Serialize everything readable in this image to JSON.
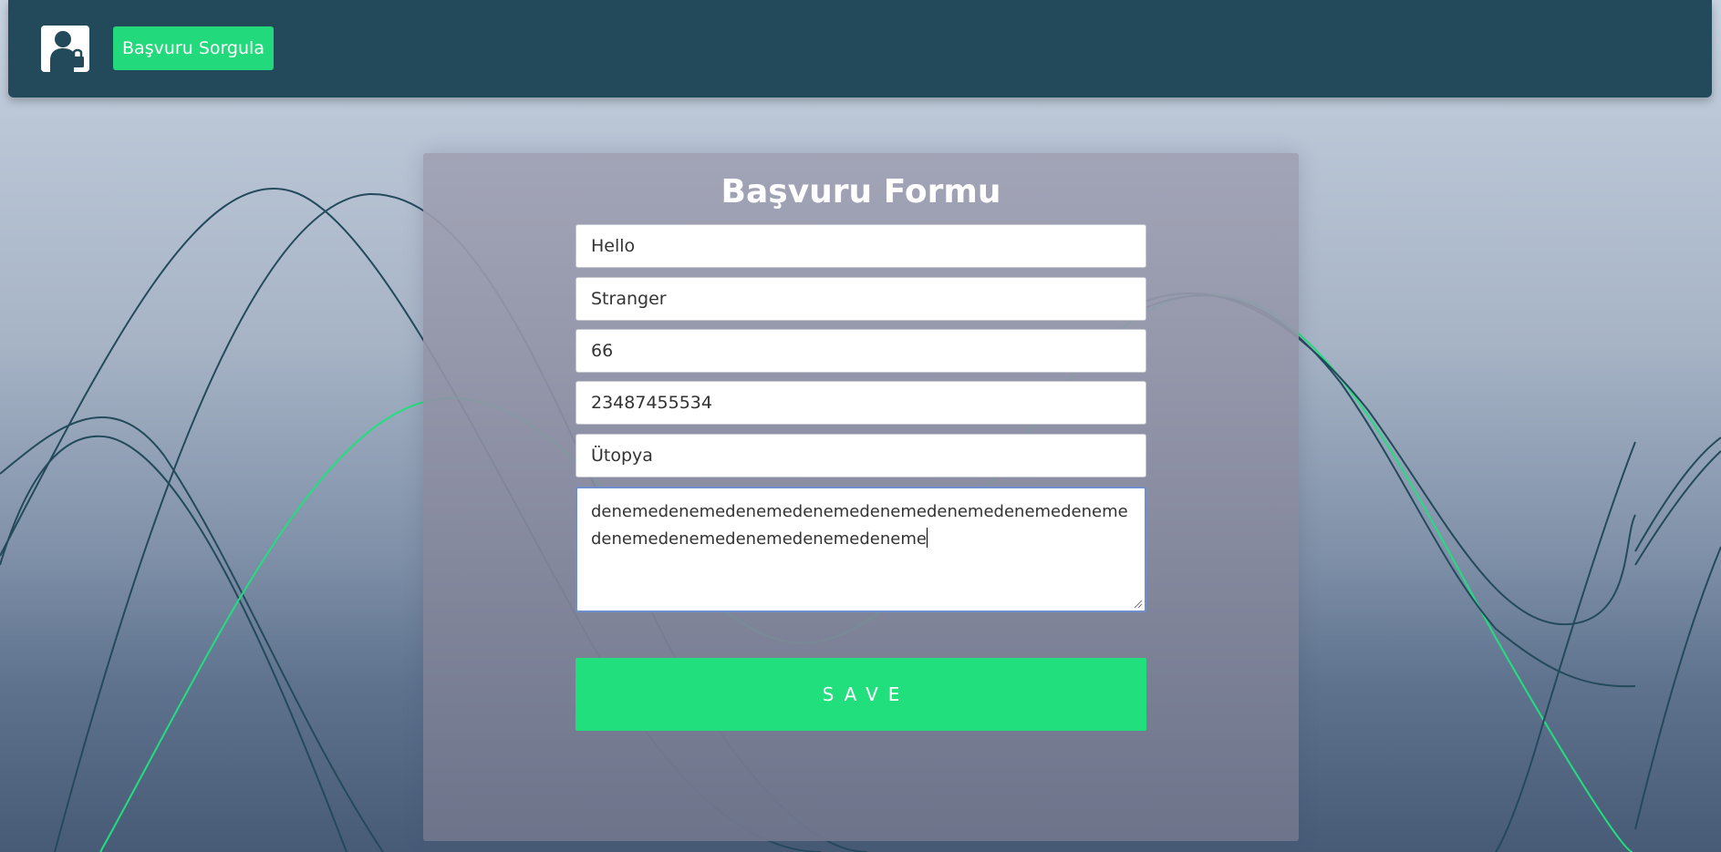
{
  "navbar": {
    "logo_icon": "user-lock-icon",
    "query_button_label": "Başvuru Sorgula",
    "background": "#234a5b",
    "accent": "#22d97b"
  },
  "form": {
    "title": "Başvuru Formu",
    "fields": [
      {
        "name": "first-name",
        "value": "Hello"
      },
      {
        "name": "last-name",
        "value": "Stranger"
      },
      {
        "name": "age",
        "value": "66"
      },
      {
        "name": "phone",
        "value": "23487455534"
      },
      {
        "name": "city",
        "value": "Ütopya"
      }
    ],
    "message_value": "denemedenemedenemedenemedenemedenemedenemedenemedenemedenemedenemedenemedeneme",
    "save_label": "SAVE"
  }
}
